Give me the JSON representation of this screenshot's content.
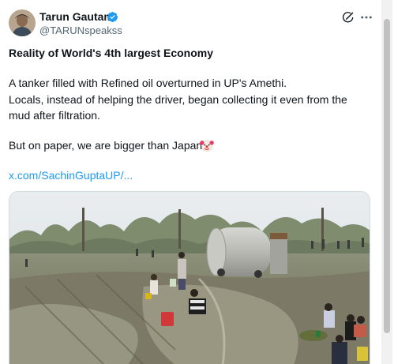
{
  "author": {
    "name": "Tarun Gautam",
    "handle": "@TARUNspeakss",
    "verified": true,
    "verified_color": "#1d9bf0"
  },
  "actions": {
    "grok_icon": "grok-icon",
    "more_icon": "more-horizontal-icon"
  },
  "post": {
    "headline": "Reality of World's 4th largest Economy",
    "line1": "A tanker filled with Refined oil overturned in UP's Amethi.",
    "line2": "Locals, instead of helping the driver, began collecting it even from the",
    "line3": "mud after filtration.",
    "line4": "But on paper, we are bigger than Japan",
    "emoji": "clown-face-emoji",
    "link": "x.com/SachinGuptaUP/..."
  },
  "media": {
    "kind": "photo",
    "icon": "video-thumbnail"
  },
  "colors": {
    "text": "#0f1419",
    "secondary": "#536471",
    "link": "#1d9bf0"
  }
}
